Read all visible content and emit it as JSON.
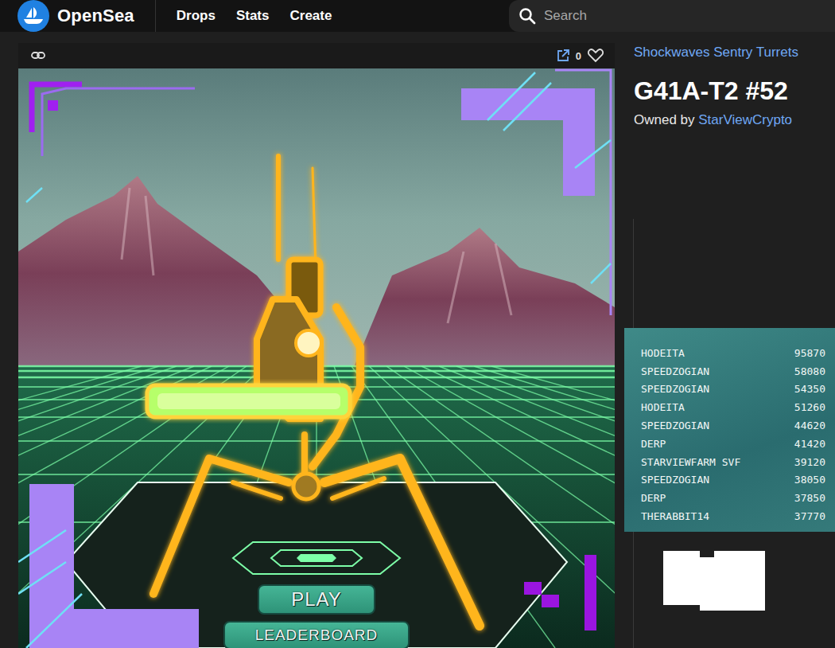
{
  "nav": {
    "logo": "OpenSea",
    "links": [
      "Drops",
      "Stats",
      "Create"
    ],
    "search": {
      "placeholder": "Search"
    }
  },
  "card": {
    "likes": "0"
  },
  "game": {
    "buttons": [
      "PLAY",
      "LEADERBOARD"
    ]
  },
  "item": {
    "collection": "Shockwaves Sentry Turrets",
    "title": "G41A-T2 #52",
    "owner_label": "Owned by",
    "owner": "StarViewCrypto"
  },
  "leaderboard": {
    "rows": [
      {
        "name": "HODEITA",
        "score": "95870"
      },
      {
        "name": "SPEEDZOGIAN",
        "score": "58080"
      },
      {
        "name": "SPEEDZOGIAN",
        "score": "54350"
      },
      {
        "name": "HODEITA",
        "score": "51260"
      },
      {
        "name": "SPEEDZOGIAN",
        "score": "44620"
      },
      {
        "name": "DERP",
        "score": "41420"
      },
      {
        "name": "STARVIEWFARM SVF",
        "score": "39120"
      },
      {
        "name": "SPEEDZOGIAN",
        "score": "38050"
      },
      {
        "name": "DERP",
        "score": "37850"
      },
      {
        "name": "THERABBIT14",
        "score": "37770"
      }
    ]
  }
}
